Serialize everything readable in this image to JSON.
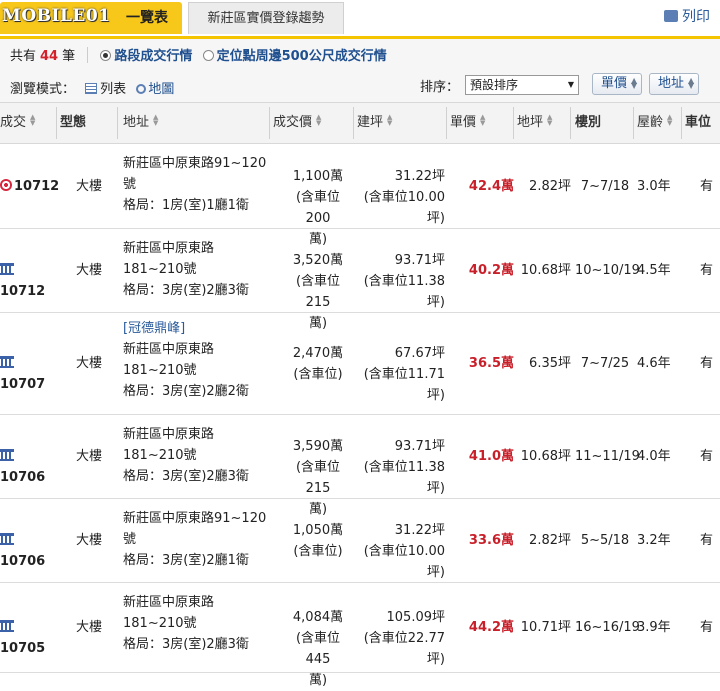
{
  "tabs": {
    "logo": "MOBILE01",
    "active_label": "一覽表",
    "second_label": "新莊區實價登錄趨勢",
    "print_label": "列印"
  },
  "summary": {
    "prefix": "共有",
    "count": "44",
    "suffix": "筆",
    "option_road": "路段成交行情",
    "option_radius": "定位點周邊500公尺成交行情"
  },
  "view": {
    "label": "瀏覽模式：",
    "list": "列表",
    "map": "地圖",
    "sort_label": "排序：",
    "sort_value": "預設排序",
    "btn_unit_price": "單價",
    "btn_land": "地址"
  },
  "columns": {
    "deal": "成交",
    "type": "型態",
    "address": "地址",
    "price": "成交價",
    "area": "建坪",
    "unit": "單價",
    "land": "地坪",
    "floor": "樓別",
    "age": "屋齡",
    "parking": "車位"
  },
  "rows": [
    {
      "icon": "target-icon",
      "id": "10712",
      "type": "大樓",
      "tag": "",
      "addr1": "新莊區中原東路91~120",
      "addr2": "號",
      "layout": "格局：1房(室)1廳1衛",
      "price1": "1,100萬",
      "price2": "(含車位200",
      "price3": "萬)",
      "area1": "31.22坪",
      "area2": "(含車位10.00",
      "area3": "坪)",
      "unit": "42.4萬",
      "land": "2.82坪",
      "floor": "7~7/18",
      "age": "3.0年",
      "park": "有"
    },
    {
      "icon": "bank-icon",
      "id": "10712",
      "type": "大樓",
      "tag": "",
      "addr1": "新莊區中原東路",
      "addr2": "181~210號",
      "layout": "格局：3房(室)2廳3衛",
      "price1": "3,520萬",
      "price2": "(含車位215",
      "price3": "萬)",
      "area1": "93.71坪",
      "area2": "(含車位11.38",
      "area3": "坪)",
      "unit": "40.2萬",
      "land": "10.68坪",
      "floor": "10~10/19",
      "age": "4.5年",
      "park": "有"
    },
    {
      "icon": "bank-icon",
      "id": "10707",
      "type": "大樓",
      "tag": "[冠德鼎峰]",
      "addr1": "新莊區中原東路",
      "addr2": "181~210號",
      "layout": "格局：3房(室)2廳2衛",
      "price1": "2,470萬",
      "price2": "(含車位)",
      "price3": "",
      "area1": "67.67坪",
      "area2": "(含車位11.71",
      "area3": "坪)",
      "unit": "36.5萬",
      "land": "6.35坪",
      "floor": "7~7/25",
      "age": "4.6年",
      "park": "有"
    },
    {
      "icon": "bank-icon",
      "id": "10706",
      "type": "大樓",
      "tag": "",
      "addr1": "新莊區中原東路",
      "addr2": "181~210號",
      "layout": "格局：3房(室)2廳3衛",
      "price1": "3,590萬",
      "price2": "(含車位215",
      "price3": "萬)",
      "area1": "93.71坪",
      "area2": "(含車位11.38",
      "area3": "坪)",
      "unit": "41.0萬",
      "land": "10.68坪",
      "floor": "11~11/19",
      "age": "4.0年",
      "park": "有"
    },
    {
      "icon": "bank-icon",
      "id": "10706",
      "type": "大樓",
      "tag": "",
      "addr1": "新莊區中原東路91~120",
      "addr2": "號",
      "layout": "格局：3房(室)2廳1衛",
      "price1": "1,050萬",
      "price2": "(含車位)",
      "price3": "",
      "area1": "31.22坪",
      "area2": "(含車位10.00",
      "area3": "坪)",
      "unit": "33.6萬",
      "land": "2.82坪",
      "floor": "5~5/18",
      "age": "3.2年",
      "park": "有"
    },
    {
      "icon": "bank-icon",
      "id": "10705",
      "type": "大樓",
      "tag": "",
      "addr1": "新莊區中原東路",
      "addr2": "181~210號",
      "layout": "格局：3房(室)2廳3衛",
      "price1": "4,084萬",
      "price2": "(含車位445",
      "price3": "萬)",
      "area1": "105.09坪",
      "area2": "(含車位22.77",
      "area3": "坪)",
      "unit": "44.2萬",
      "land": "10.71坪",
      "floor": "16~16/19",
      "age": "3.9年",
      "park": "有"
    }
  ]
}
